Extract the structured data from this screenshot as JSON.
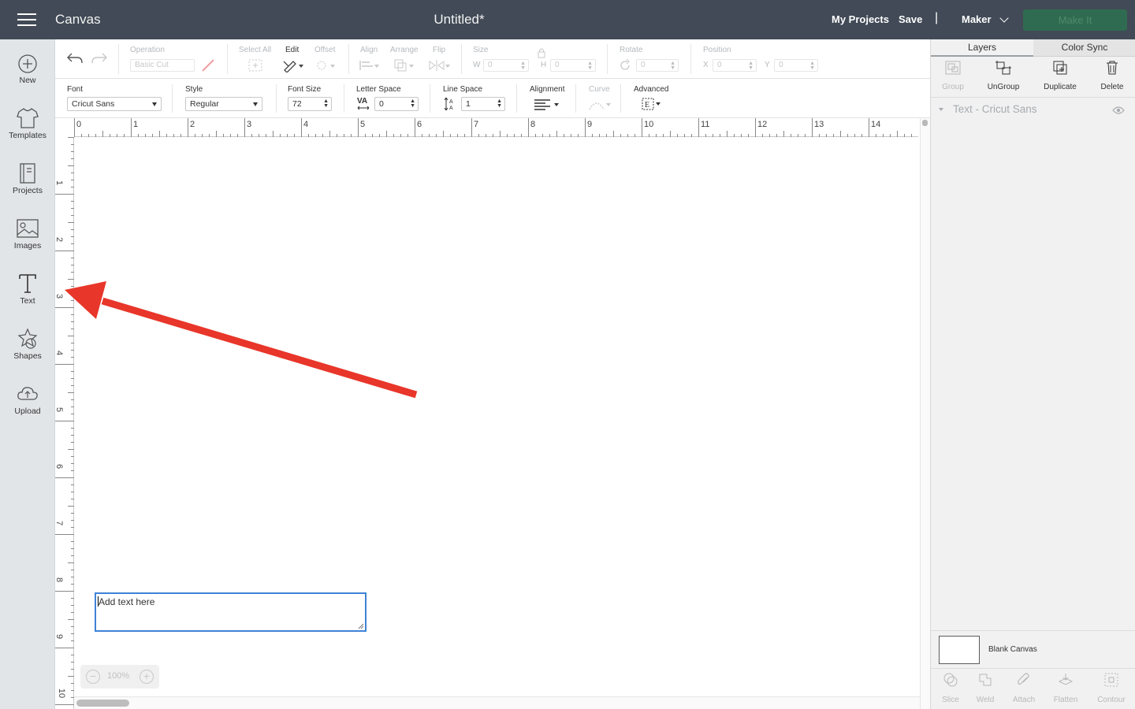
{
  "header": {
    "app_name": "Canvas",
    "doc_title": "Untitled*",
    "my_projects": "My Projects",
    "save": "Save",
    "separator": "|",
    "machine": "Maker",
    "make_it": "Make It"
  },
  "sidebar": {
    "items": [
      {
        "label": "New",
        "icon": "plus-circle-icon"
      },
      {
        "label": "Templates",
        "icon": "tshirt-icon"
      },
      {
        "label": "Projects",
        "icon": "projects-icon"
      },
      {
        "label": "Images",
        "icon": "image-icon"
      },
      {
        "label": "Text",
        "icon": "text-icon"
      },
      {
        "label": "Shapes",
        "icon": "shapes-icon"
      },
      {
        "label": "Upload",
        "icon": "upload-cloud-icon"
      }
    ]
  },
  "toolbar1": {
    "operation_label": "Operation",
    "operation_value": "Basic Cut",
    "select_all": "Select All",
    "edit": "Edit",
    "offset": "Offset",
    "align": "Align",
    "arrange": "Arrange",
    "flip": "Flip",
    "size": "Size",
    "w_label": "W",
    "w_value": "0",
    "h_label": "H",
    "h_value": "0",
    "rotate": "Rotate",
    "rotate_value": "0",
    "position": "Position",
    "x_label": "X",
    "x_value": "0",
    "y_label": "Y",
    "y_value": "0"
  },
  "toolbar2": {
    "font_label": "Font",
    "font_value": "Cricut Sans",
    "style_label": "Style",
    "style_value": "Regular",
    "font_size_label": "Font Size",
    "font_size_value": "72",
    "letter_space_label": "Letter Space",
    "letter_space_icon_text": "VA",
    "letter_space_value": "0",
    "line_space_label": "Line Space",
    "line_space_value": "1",
    "alignment_label": "Alignment",
    "curve_label": "Curve",
    "advanced_label": "Advanced"
  },
  "canvas": {
    "ruler_h": [
      "0",
      "1",
      "2",
      "3",
      "4",
      "5",
      "6",
      "7",
      "8",
      "9",
      "10",
      "11",
      "12",
      "13",
      "14"
    ],
    "ruler_v": [
      "1",
      "2",
      "3",
      "4",
      "5",
      "6",
      "7",
      "8",
      "9",
      "10"
    ],
    "text_placeholder": "Add text here",
    "zoom_value": "100%",
    "zoom_minus": "−",
    "zoom_plus": "+",
    "annotation_color": "#e8362a"
  },
  "right_panel": {
    "tabs": [
      "Layers",
      "Color Sync"
    ],
    "actions": [
      "Group",
      "UnGroup",
      "Duplicate",
      "Delete"
    ],
    "layer_name": "Text - Cricut Sans",
    "blank_canvas": "Blank Canvas",
    "bottom_actions": [
      "Slice",
      "Weld",
      "Attach",
      "Flatten",
      "Contour"
    ]
  },
  "colors": {
    "topbar": "#414a56",
    "make_it_button": "#2f6b50",
    "textbox_border": "#3f82d6"
  }
}
